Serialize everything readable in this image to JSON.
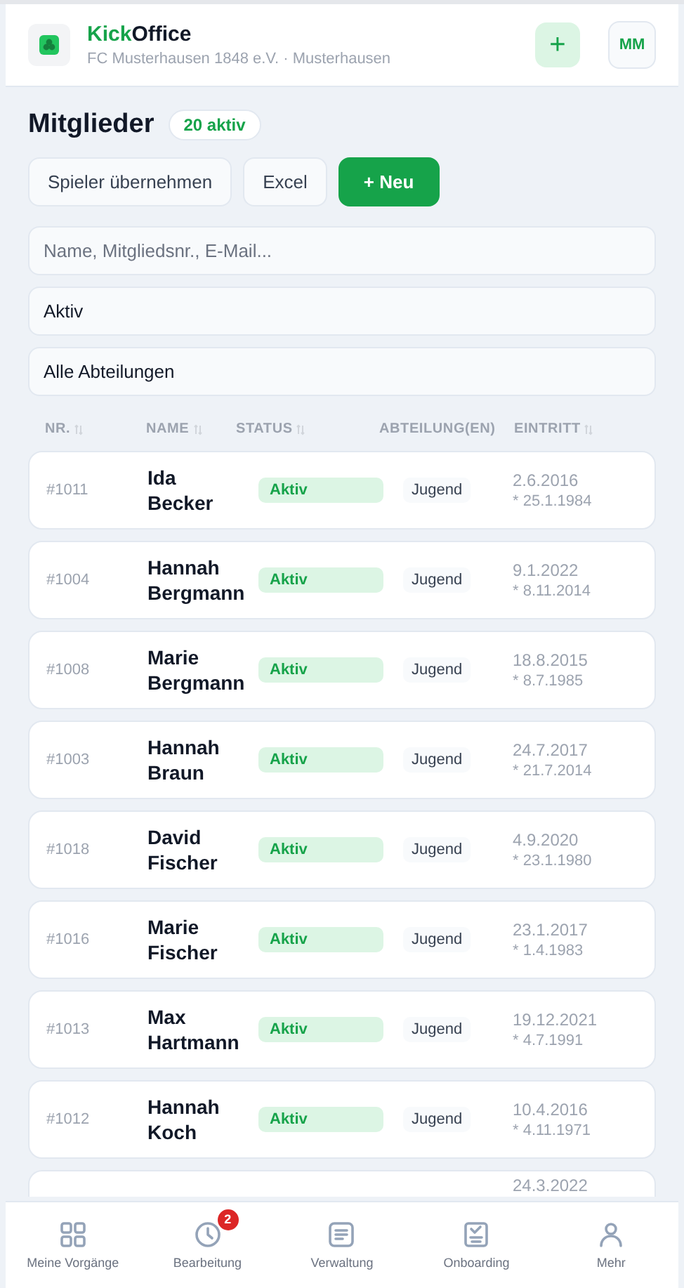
{
  "header": {
    "brand_first": "Kick",
    "brand_second": "Office",
    "subtitle": "FC Musterhausen 1848 e.V. · Musterhausen",
    "add_label": "+",
    "avatar": "MM"
  },
  "page": {
    "title": "Mitglieder",
    "count_badge": "20 aktiv"
  },
  "actions": [
    {
      "label": "Spieler übernehmen",
      "kind": "secondary"
    },
    {
      "label": "Excel",
      "kind": "secondary"
    },
    {
      "label": "+ Neu",
      "kind": "primary"
    }
  ],
  "filters": [
    {
      "placeholder": "Name, Mitgliedsnr., E-Mail..."
    },
    {
      "value": "Aktiv"
    },
    {
      "value": "Alle Abteilungen"
    }
  ],
  "table": {
    "columns": [
      {
        "label": "NR.",
        "sortable": true
      },
      {
        "label": "NAME",
        "sortable": true
      },
      {
        "label": "STATUS",
        "sortable": true
      },
      {
        "label": "ABTEILUNG(EN)",
        "sortable": false
      },
      {
        "label": "EINTRITT",
        "sortable": true
      }
    ],
    "rows": [
      {
        "nr": "#1011",
        "name": "Ida Becker",
        "status": "Aktiv",
        "department": "Jugend",
        "joined": "2.6.2016",
        "born": "* 25.1.1984"
      },
      {
        "nr": "#1004",
        "name": "Hannah Bergmann",
        "status": "Aktiv",
        "department": "Jugend",
        "joined": "9.1.2022",
        "born": "* 8.11.2014"
      },
      {
        "nr": "#1008",
        "name": "Marie Bergmann",
        "status": "Aktiv",
        "department": "Jugend",
        "joined": "18.8.2015",
        "born": "* 8.7.1985"
      },
      {
        "nr": "#1003",
        "name": "Hannah Braun",
        "status": "Aktiv",
        "department": "Jugend",
        "joined": "24.7.2017",
        "born": "* 21.7.2014"
      },
      {
        "nr": "#1018",
        "name": "David Fischer",
        "status": "Aktiv",
        "department": "Jugend",
        "joined": "4.9.2020",
        "born": "* 23.1.1980"
      },
      {
        "nr": "#1016",
        "name": "Marie Fischer",
        "status": "Aktiv",
        "department": "Jugend",
        "joined": "23.1.2017",
        "born": "* 1.4.1983"
      },
      {
        "nr": "#1013",
        "name": "Max Hartmann",
        "status": "Aktiv",
        "department": "Jugend",
        "joined": "19.12.2021",
        "born": "* 4.7.1991"
      },
      {
        "nr": "#1012",
        "name": "Hannah Koch",
        "status": "Aktiv",
        "department": "Jugend",
        "joined": "10.4.2016",
        "born": "* 4.11.1971"
      }
    ],
    "partial_row": {
      "joined": "24.3.2022"
    }
  },
  "nav": [
    {
      "label": "Meine Vorgänge",
      "kind": "grid"
    },
    {
      "label": "Bearbeitung",
      "kind": "clock",
      "badge": "2"
    },
    {
      "label": "Verwaltung",
      "kind": "document"
    },
    {
      "label": "Onboarding",
      "kind": "checklist"
    },
    {
      "label": "Mehr",
      "kind": "person"
    }
  ]
}
